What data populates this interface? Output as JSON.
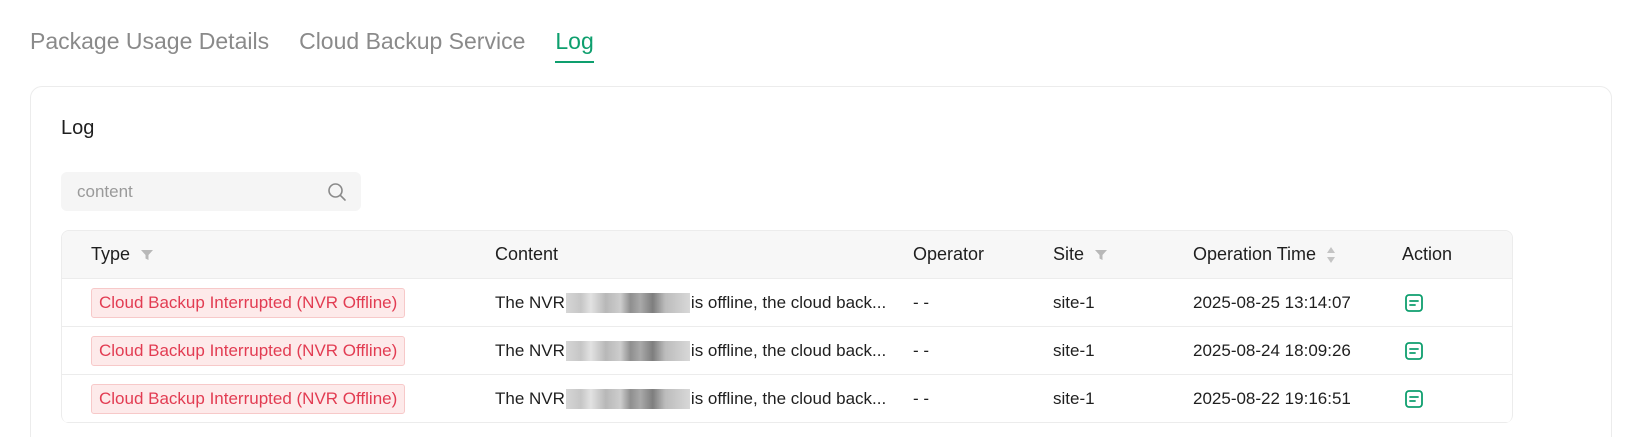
{
  "tabs": [
    {
      "label": "Package Usage Details",
      "active": false
    },
    {
      "label": "Cloud Backup Service",
      "active": false
    },
    {
      "label": "Log",
      "active": true
    }
  ],
  "card": {
    "title": "Log",
    "search": {
      "placeholder": "content",
      "value": ""
    }
  },
  "table": {
    "headers": {
      "type": "Type",
      "content": "Content",
      "operator": "Operator",
      "site": "Site",
      "time": "Operation Time",
      "action": "Action"
    },
    "rows": [
      {
        "type": "Cloud Backup Interrupted (NVR Offline)",
        "content_prefix": "The NVR",
        "content_suffix": "is offline, the cloud back...",
        "operator": "- -",
        "site": "site-1",
        "time": "2025-08-25 13:14:07"
      },
      {
        "type": "Cloud Backup Interrupted (NVR Offline)",
        "content_prefix": "The NVR",
        "content_suffix": "is offline, the cloud back...",
        "operator": "- -",
        "site": "site-1",
        "time": "2025-08-24 18:09:26"
      },
      {
        "type": "Cloud Backup Interrupted (NVR Offline)",
        "content_prefix": "The NVR",
        "content_suffix": "is offline, the cloud back...",
        "operator": "- -",
        "site": "site-1",
        "time": "2025-08-22 19:16:51"
      }
    ]
  },
  "icons": {
    "search": "search-icon",
    "filter": "filter-icon",
    "sort": "sort-icon",
    "details": "details-icon"
  },
  "colors": {
    "accent": "#0e9f6e",
    "badge_text": "#e23c52",
    "badge_bg": "#fdeaea"
  }
}
